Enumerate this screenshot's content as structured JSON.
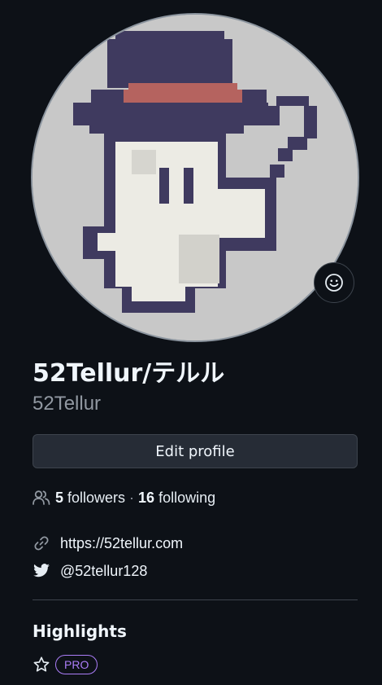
{
  "profile": {
    "fullname": "52Tellur/テルル",
    "username": "52Tellur"
  },
  "actions": {
    "edit_profile_label": "Edit profile"
  },
  "stats": {
    "followers_count": "5",
    "followers_label": "followers",
    "separator": "·",
    "following_count": "16",
    "following_label": "following"
  },
  "links": {
    "website": "https://52tellur.com",
    "twitter": "@52tellur128"
  },
  "highlights": {
    "title": "Highlights",
    "pro_badge": "PRO"
  },
  "colors": {
    "background": "#0d1117",
    "avatar_bg": "#c8c8c8",
    "hat": "#3f3a5f",
    "hat_band": "#b5635f",
    "ghost": "#ecebe4",
    "pro_accent": "#ab7df8"
  },
  "icons": {
    "status": "smiley-icon",
    "people": "people-icon",
    "link": "link-icon",
    "twitter": "twitter-bird-icon",
    "star": "star-icon"
  }
}
